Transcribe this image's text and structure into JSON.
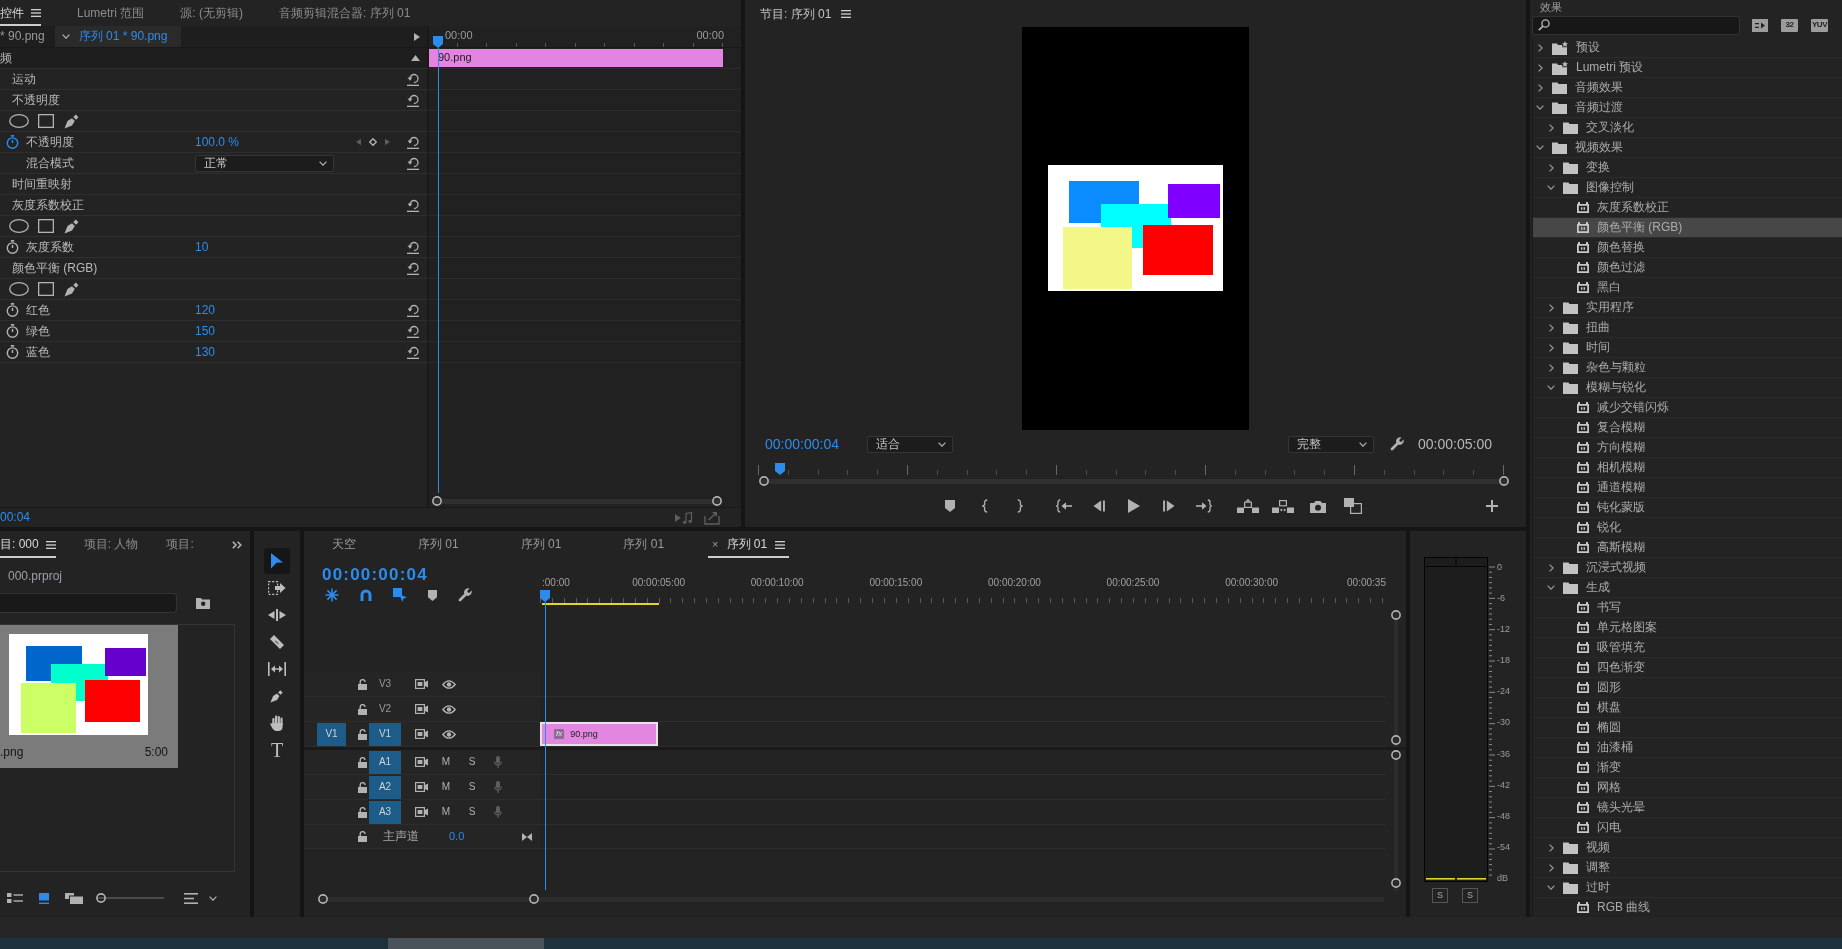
{
  "effect_controls": {
    "tabs": [
      {
        "label": "控件",
        "selected": true
      },
      {
        "label": "Lumetri 范围",
        "selected": false
      },
      {
        "label": "源: (无剪辑)",
        "selected": false
      },
      {
        "label": "音频剪辑混合器: 序列 01",
        "selected": false
      }
    ],
    "clip_tabs": [
      {
        "label": "* 90.png",
        "selected": false
      },
      {
        "label": "序列 01 * 90.png",
        "selected": true
      }
    ],
    "section": "频",
    "rows": [
      {
        "kind": "effect",
        "label": "运动",
        "reset": true
      },
      {
        "kind": "effect",
        "label": "不透明度",
        "reset": true
      },
      {
        "kind": "masks"
      },
      {
        "kind": "param",
        "label": "不透明度",
        "value": "100.0 %",
        "animated": true,
        "reset": true
      },
      {
        "kind": "select",
        "label": "混合模式",
        "value": "正常",
        "reset": true
      },
      {
        "kind": "effect",
        "label": "时间重映射",
        "reset": false
      },
      {
        "kind": "effect",
        "label": "灰度系数校正",
        "reset": true
      },
      {
        "kind": "masks"
      },
      {
        "kind": "param",
        "label": "灰度系数",
        "value": "10",
        "animated": false,
        "reset": true
      },
      {
        "kind": "effect",
        "label": "颜色平衡 (RGB)",
        "reset": true
      },
      {
        "kind": "masks"
      },
      {
        "kind": "param",
        "label": "红色",
        "value": "120",
        "animated": false,
        "reset": true
      },
      {
        "kind": "param",
        "label": "绿色",
        "value": "150",
        "animated": false,
        "reset": true
      },
      {
        "kind": "param",
        "label": "蓝色",
        "value": "130",
        "animated": false,
        "reset": true
      }
    ],
    "ruler": [
      "00:00",
      "00:00"
    ],
    "clip": "90.png",
    "playhead": {
      "level": 0.03
    },
    "timecode": "00:04"
  },
  "program_monitor": {
    "title": "节目: 序列 01",
    "timecode": "00:00:00:04",
    "fit": "适合",
    "quality": "完整",
    "duration": "00:00:05:00",
    "playhead": {
      "level": 0.03
    }
  },
  "effects": {
    "title": "效果",
    "filters": [
      {
        "kind": "icon"
      },
      {
        "kind": "text",
        "label": "32"
      },
      {
        "kind": "text",
        "label": "YUV"
      }
    ],
    "tree": [
      {
        "kind": "preset",
        "label": "预设",
        "expanded": false,
        "selected": false
      },
      {
        "kind": "preset",
        "label": "Lumetri 预设",
        "expanded": false,
        "selected": false
      },
      {
        "kind": "folder",
        "label": "音频效果",
        "expanded": false,
        "selected": false
      },
      {
        "kind": "folder",
        "label": "音频过渡",
        "expanded": true,
        "selected": false,
        "children": [
          {
            "kind": "folder",
            "label": "交叉淡化",
            "expanded": false,
            "selected": false
          }
        ]
      },
      {
        "kind": "folder",
        "label": "视频效果",
        "expanded": true,
        "selected": false,
        "children": [
          {
            "kind": "folder",
            "label": "变换",
            "expanded": false,
            "selected": false
          },
          {
            "kind": "folder",
            "label": "图像控制",
            "expanded": true,
            "selected": false,
            "children": [
              {
                "kind": "effect",
                "label": "灰度系数校正",
                "selected": false
              },
              {
                "kind": "effect",
                "label": "颜色平衡 (RGB)",
                "selected": true
              },
              {
                "kind": "effect",
                "label": "颜色替换",
                "selected": false
              },
              {
                "kind": "effect",
                "label": "颜色过滤",
                "selected": false
              },
              {
                "kind": "effect",
                "label": "黑白",
                "selected": false
              }
            ]
          },
          {
            "kind": "folder",
            "label": "实用程序",
            "expanded": false,
            "selected": false
          },
          {
            "kind": "folder",
            "label": "扭曲",
            "expanded": false,
            "selected": false
          },
          {
            "kind": "folder",
            "label": "时间",
            "expanded": false,
            "selected": false
          },
          {
            "kind": "folder",
            "label": "杂色与颗粒",
            "expanded": false,
            "selected": false
          },
          {
            "kind": "folder",
            "label": "模糊与锐化",
            "expanded": true,
            "selected": false,
            "children": [
              {
                "kind": "effect",
                "label": "减少交错闪烁",
                "selected": false
              },
              {
                "kind": "effect",
                "label": "复合模糊",
                "selected": false
              },
              {
                "kind": "effect",
                "label": "方向模糊",
                "selected": false
              },
              {
                "kind": "effect",
                "label": "相机模糊",
                "selected": false
              },
              {
                "kind": "effect",
                "label": "通道模糊",
                "selected": false
              },
              {
                "kind": "effect",
                "label": "钝化蒙版",
                "selected": false
              },
              {
                "kind": "effect",
                "label": "锐化",
                "selected": false
              },
              {
                "kind": "effect",
                "label": "高斯模糊",
                "selected": false
              }
            ]
          },
          {
            "kind": "folder",
            "label": "沉浸式视频",
            "expanded": false,
            "selected": false
          },
          {
            "kind": "folder",
            "label": "生成",
            "expanded": true,
            "selected": false,
            "children": [
              {
                "kind": "effect",
                "label": "书写",
                "selected": false
              },
              {
                "kind": "effect",
                "label": "单元格图案",
                "selected": false
              },
              {
                "kind": "effect",
                "label": "吸管填充",
                "selected": false
              },
              {
                "kind": "effect",
                "label": "四色渐变",
                "selected": false
              },
              {
                "kind": "effect",
                "label": "圆形",
                "selected": false
              },
              {
                "kind": "effect",
                "label": "棋盘",
                "selected": false
              },
              {
                "kind": "effect",
                "label": "椭圆",
                "selected": false
              },
              {
                "kind": "effect",
                "label": "油漆桶",
                "selected": false
              },
              {
                "kind": "effect",
                "label": "渐变",
                "selected": false
              },
              {
                "kind": "effect",
                "label": "网格",
                "selected": false
              },
              {
                "kind": "effect",
                "label": "镜头光晕",
                "selected": false
              },
              {
                "kind": "effect",
                "label": "闪电",
                "selected": false
              }
            ]
          },
          {
            "kind": "folder",
            "label": "视频",
            "expanded": false,
            "selected": false
          },
          {
            "kind": "folder",
            "label": "调整",
            "expanded": false,
            "selected": false
          },
          {
            "kind": "folder",
            "label": "过时",
            "expanded": true,
            "selected": false,
            "children": [
              {
                "kind": "effect",
                "label": "RGB 曲线",
                "selected": false
              }
            ]
          }
        ]
      }
    ]
  },
  "project": {
    "tabs": [
      {
        "label": "目: 000",
        "selected": true
      },
      {
        "label": "项目: 人物",
        "selected": false
      },
      {
        "label": "项目:",
        "selected": false
      }
    ],
    "path": "000.prproj",
    "item": {
      "name": ".png",
      "duration": "5:00"
    },
    "views": [
      {
        "kind": "list",
        "selected": false
      },
      {
        "kind": "icon",
        "selected": true
      },
      {
        "kind": "freeform",
        "selected": false
      }
    ],
    "zoom": {
      "level": 0
    }
  },
  "tools": [
    {
      "kind": "selection",
      "selected": true
    },
    {
      "kind": "track_select",
      "selected": false
    },
    {
      "kind": "ripple",
      "selected": false
    },
    {
      "kind": "razor",
      "selected": false
    },
    {
      "kind": "slip",
      "selected": false
    },
    {
      "kind": "pen",
      "selected": false
    },
    {
      "kind": "hand",
      "selected": false
    },
    {
      "kind": "type",
      "label": "T",
      "selected": false
    }
  ],
  "timeline": {
    "tabs": [
      {
        "label": "天空",
        "selected": false
      },
      {
        "label": "序列 01",
        "selected": false
      },
      {
        "label": "序列 01",
        "selected": false
      },
      {
        "label": "序列 01",
        "selected": false
      },
      {
        "label": "序列 01",
        "selected": true,
        "close": "×"
      }
    ],
    "timecode": "00:00:00:04",
    "toolbar": [
      {
        "kind": "nest",
        "on": true
      },
      {
        "kind": "snap",
        "on": true
      },
      {
        "kind": "linked",
        "on": true
      },
      {
        "kind": "marker"
      },
      {
        "kind": "settings"
      }
    ],
    "ruler": [
      ":00:00",
      "00:00:05:00",
      "00:00:10:00",
      "00:00:15:00",
      "00:00:20:00",
      "00:00:25:00",
      "00:00:30:00",
      "00:00:35"
    ],
    "playhead": {
      "level": 0.006
    },
    "video_tracks": [
      {
        "name": "V3",
        "targeted": false
      },
      {
        "name": "V2",
        "targeted": false
      },
      {
        "name": "V1",
        "targeted": true,
        "source": "V1",
        "clip": {
          "name": "90.png",
          "badge": "fx",
          "selected": true
        }
      }
    ],
    "audio_tracks": [
      {
        "name": "A1",
        "targeted": true,
        "mute": "M",
        "solo": "S"
      },
      {
        "name": "A2",
        "targeted": true,
        "mute": "M",
        "solo": "S"
      },
      {
        "name": "A3",
        "targeted": true,
        "mute": "M",
        "solo": "S"
      }
    ],
    "master": {
      "label": "主声道",
      "volume": "0.0"
    }
  },
  "audio_meter": {
    "scale": [
      "0",
      "-6",
      "-12",
      "-18",
      "-24",
      "-30",
      "-36",
      "-42",
      "-48",
      "-54",
      "dB"
    ],
    "solo": [
      "S",
      "S"
    ]
  },
  "taskbar": {
    "buttons": [
      {
        "selected": true
      }
    ]
  }
}
